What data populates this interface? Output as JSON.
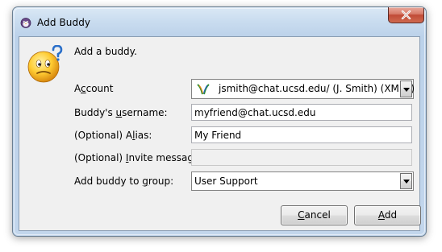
{
  "window": {
    "title": "Add Buddy"
  },
  "heading": "Add a buddy.",
  "form": {
    "account_label_pre": "A",
    "account_label_ul": "c",
    "account_label_post": "count",
    "account_value": "jsmith@chat.ucsd.edu/ (J. Smith) (XMPP)",
    "username_label_pre": "Buddy's ",
    "username_label_ul": "u",
    "username_label_post": "sername:",
    "username_value": "myfriend@chat.ucsd.edu",
    "alias_label_pre": "(Optional) A",
    "alias_label_ul": "l",
    "alias_label_post": "ias:",
    "alias_value": "My Friend",
    "invite_label_pre": "(Optional) ",
    "invite_label_ul": "I",
    "invite_label_post": "nvite message:",
    "invite_value": "",
    "group_label_pre": "Add buddy to ",
    "group_label_ul": "g",
    "group_label_post": "roup:",
    "group_value": "User Support"
  },
  "buttons": {
    "cancel_ul": "C",
    "cancel_rest": "ancel",
    "add_ul": "A",
    "add_rest": "dd"
  },
  "icons": {
    "app": "pidgin-icon",
    "buddy": "buddy-question-icon",
    "account_protocol": "xmpp-icon",
    "close": "close-icon"
  }
}
